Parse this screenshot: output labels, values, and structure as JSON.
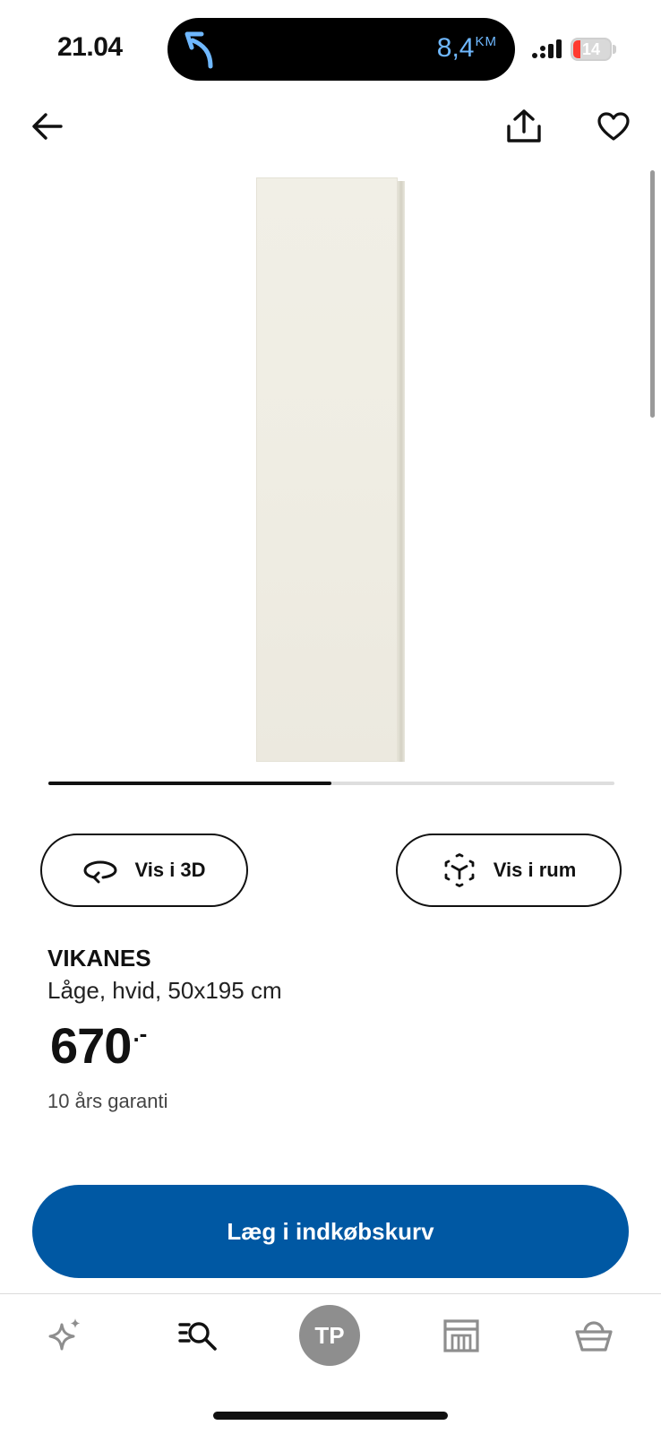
{
  "status_bar": {
    "time": "21.04",
    "navigation_distance": "8,4",
    "navigation_unit": "KM",
    "battery_level": "14",
    "colors": {
      "distance": "#6fb8ff",
      "battery_low": "#ff3b30"
    }
  },
  "header": {
    "back_icon": "arrow-left-icon",
    "share_icon": "share-icon",
    "favourite_icon": "heart-icon"
  },
  "gallery": {
    "progress_fraction": 0.5
  },
  "actions": {
    "view_3d_label": "Vis i 3D",
    "view_in_room_label": "Vis i rum"
  },
  "product": {
    "name": "VIKANES",
    "description": "Låge, hvid, 50x195 cm",
    "price": "670",
    "price_suffix": ".-",
    "warranty": "10 års garanti"
  },
  "cart_button": {
    "label": "Læg i indkøbskurv",
    "color": "#0058a3"
  },
  "tabbar": {
    "items": [
      {
        "name": "inspiration",
        "icon": "sparkle-icon"
      },
      {
        "name": "search",
        "icon": "search-list-icon"
      },
      {
        "name": "profile",
        "initials": "TP"
      },
      {
        "name": "store",
        "icon": "store-icon"
      },
      {
        "name": "cart",
        "icon": "basket-icon"
      }
    ]
  }
}
